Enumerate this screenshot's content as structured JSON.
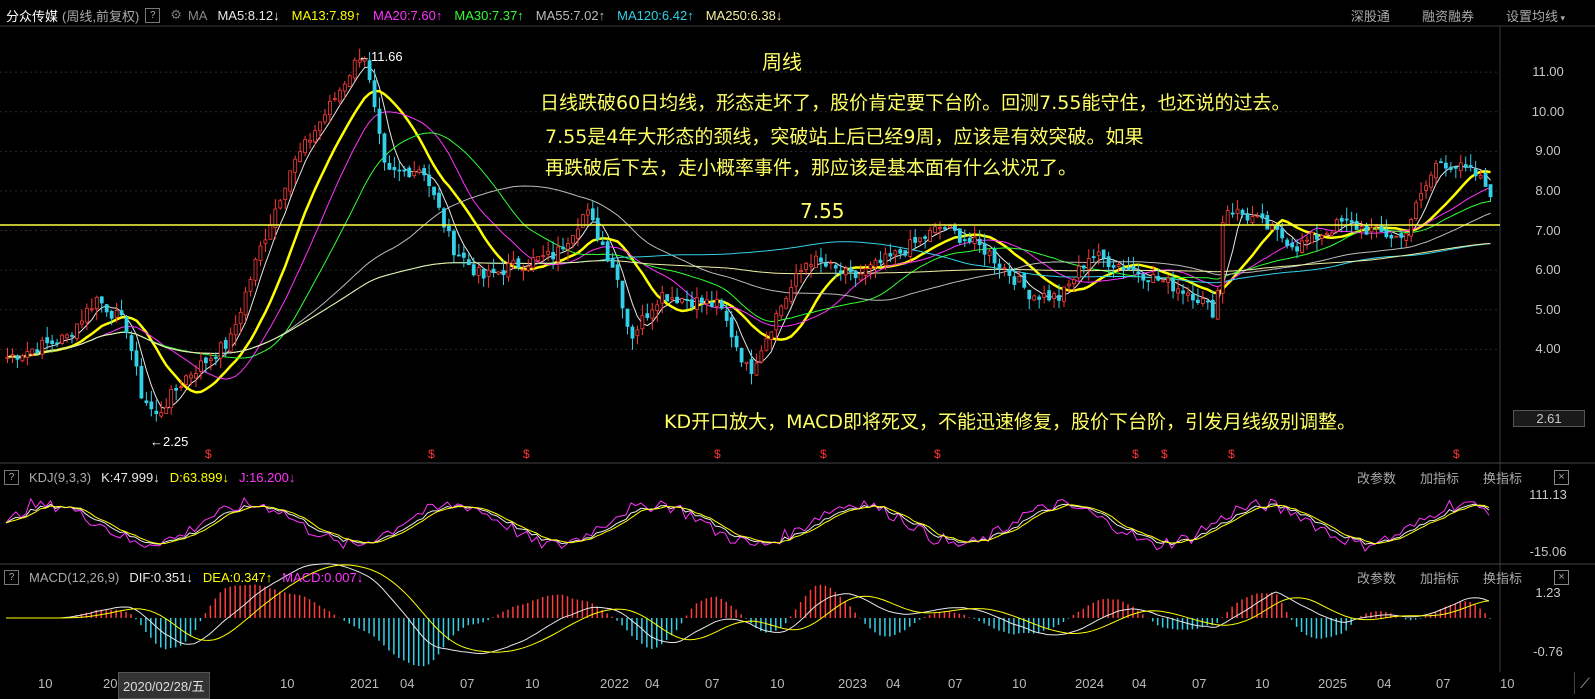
{
  "header": {
    "stock_name": "分众传媒",
    "mode": "(周线,前复权)",
    "help": "?",
    "ma_label": "MA",
    "ma_values": [
      {
        "text": "MA5:8.12",
        "arrow": "↓",
        "color": "#e8e8e8"
      },
      {
        "text": "MA13:7.89",
        "arrow": "↑",
        "color": "#ffff00"
      },
      {
        "text": "MA20:7.60",
        "arrow": "↑",
        "color": "#ff33ff"
      },
      {
        "text": "MA30:7.37",
        "arrow": "↑",
        "color": "#33ff33"
      },
      {
        "text": "MA55:7.02",
        "arrow": "↑",
        "color": "#bbbbbb"
      },
      {
        "text": "MA120:6.42",
        "arrow": "↑",
        "color": "#33d0e8"
      },
      {
        "text": "MA250:6.38",
        "arrow": "↓",
        "color": "#f0f0a0"
      }
    ],
    "buttons": [
      "深股通",
      "融资融券",
      "设置均线"
    ]
  },
  "annotations": {
    "title": "周线",
    "line1": "日线跌破60日均线，形态走坏了，股价肯定要下台阶。回测7.55能守住，也还说的过去。",
    "line2": "7.55是4年大形态的颈线，突破站上后已经9周，应该是有效突破。如果",
    "line3": "再跌破后下去，走小概率事件，那应该是基本面有什么状况了。",
    "level_label": "7.55",
    "bottom": "KD开口放大，MACD即将死叉，不能迅速修复，股价下台阶，引发月线级别调整。",
    "high_marker": "←11.66",
    "low_marker": "←2.25"
  },
  "price_axis": [
    "11.00",
    "10.00",
    "9.00",
    "8.00",
    "7.00",
    "6.00",
    "5.00",
    "4.00"
  ],
  "price_axis_current": "2.61",
  "kdj": {
    "help": "?",
    "label": "KDJ(9,3,3)",
    "k": "K:47.999",
    "k_arrow": "↓",
    "d": "D:63.899",
    "d_arrow": "↓",
    "j": "J:16.200",
    "j_arrow": "↓",
    "axis_top": "111.13",
    "axis_bottom": "-15.06",
    "buttons": [
      "改参数",
      "加指标",
      "换指标"
    ]
  },
  "macd": {
    "help": "?",
    "label": "MACD(12,26,9)",
    "dif": "DIF:0.351",
    "dif_arrow": "↓",
    "dea": "DEA:0.347",
    "dea_arrow": "↑",
    "macd": "MACD:0.007",
    "macd_arrow": "↓",
    "axis_top": "1.23",
    "axis_bottom": "-0.76",
    "buttons": [
      "改参数",
      "加指标",
      "换指标"
    ]
  },
  "date_axis": [
    {
      "label": "10",
      "pos": 38
    },
    {
      "label": "2020",
      "pos": 103
    },
    {
      "label": "10",
      "pos": 280
    },
    {
      "label": "2021",
      "pos": 350
    },
    {
      "label": "04",
      "pos": 400
    },
    {
      "label": "07",
      "pos": 460
    },
    {
      "label": "10",
      "pos": 525
    },
    {
      "label": "2022",
      "pos": 600
    },
    {
      "label": "04",
      "pos": 645
    },
    {
      "label": "07",
      "pos": 705
    },
    {
      "label": "10",
      "pos": 770
    },
    {
      "label": "2023",
      "pos": 838
    },
    {
      "label": "04",
      "pos": 886
    },
    {
      "label": "07",
      "pos": 948
    },
    {
      "label": "10",
      "pos": 1012
    },
    {
      "label": "2024",
      "pos": 1075
    },
    {
      "label": "04",
      "pos": 1132
    },
    {
      "label": "07",
      "pos": 1192
    },
    {
      "label": "10",
      "pos": 1255
    },
    {
      "label": "2025",
      "pos": 1318
    },
    {
      "label": "04",
      "pos": 1377
    },
    {
      "label": "07",
      "pos": 1436
    },
    {
      "label": "10",
      "pos": 1500
    }
  ],
  "date_cursor": "2020/02/28/五",
  "dividend_marker": "$",
  "colors": {
    "up": "#ff3b3b",
    "down": "#33d0e8",
    "level": "#ffff44"
  }
}
